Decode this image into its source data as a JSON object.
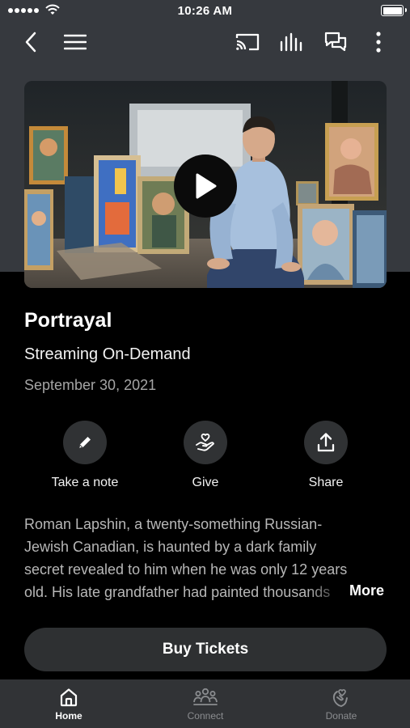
{
  "status_bar": {
    "time": "10:26 AM"
  },
  "nav": {
    "icons": [
      "back-chevron-icon",
      "menu-icon",
      "cast-icon",
      "audio-levels-icon",
      "chat-icon",
      "more-vertical-icon"
    ]
  },
  "hero": {
    "play_icon": "play-icon"
  },
  "event": {
    "title": "Portrayal",
    "subtitle": "Streaming On-Demand",
    "date": "September 30, 2021"
  },
  "actions": [
    {
      "label": "Take a note",
      "icon": "pencil-icon"
    },
    {
      "label": "Give",
      "icon": "heart-hand-icon"
    },
    {
      "label": "Share",
      "icon": "share-icon"
    }
  ],
  "description": {
    "lines": [
      "Roman Lapshin, a twenty-something Russian-",
      "Jewish Canadian, is haunted by a dark family",
      "secret revealed to him when he was only 12 years",
      "old. His late grandfather had painted thousands"
    ],
    "more_label": "More"
  },
  "buy_button": {
    "label": "Buy Tickets"
  },
  "tabs": [
    {
      "label": "Home",
      "icon": "home-icon",
      "active": true
    },
    {
      "label": "Connect",
      "icon": "people-icon",
      "active": false
    },
    {
      "label": "Donate",
      "icon": "donate-icon",
      "active": false
    }
  ],
  "colors": {
    "header_background": "#36393e",
    "page_background": "#000000",
    "button_background": "#2e3032",
    "tab_bar_background": "#313336",
    "tab_inactive": "#8b8d90"
  }
}
